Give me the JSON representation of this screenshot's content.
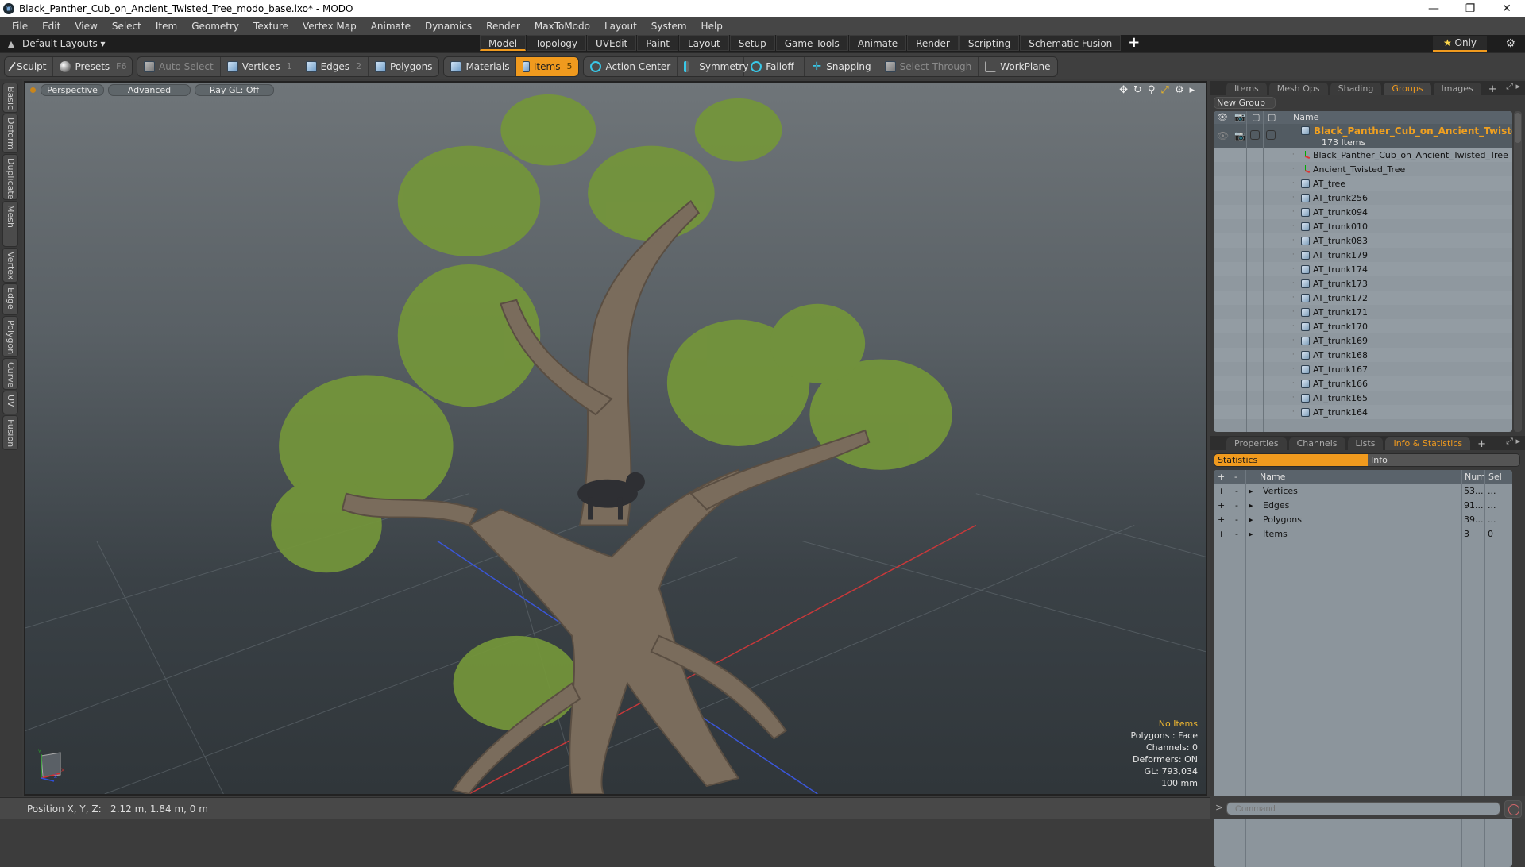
{
  "window": {
    "title": "Black_Panther_Cub_on_Ancient_Twisted_Tree_modo_base.lxo* - MODO",
    "controls": [
      "minimize",
      "maximize",
      "close"
    ]
  },
  "menu": [
    "File",
    "Edit",
    "View",
    "Select",
    "Item",
    "Geometry",
    "Texture",
    "Vertex Map",
    "Animate",
    "Dynamics",
    "Render",
    "MaxToModo",
    "Layout",
    "System",
    "Help"
  ],
  "layouts": {
    "dropdown_label": "Default Layouts",
    "tabs": [
      "Model",
      "Topology",
      "UVEdit",
      "Paint",
      "Layout",
      "Setup",
      "Game Tools",
      "Animate",
      "Render",
      "Scripting",
      "Schematic Fusion"
    ],
    "active_tab": "Model",
    "add_label": "+",
    "only_label": "Only"
  },
  "toolbar": {
    "sculpt": "Sculpt",
    "presets": "Presets",
    "presets_key": "F6",
    "auto_select": "Auto Select",
    "vertices": "Vertices",
    "vertices_key": "1",
    "edges": "Edges",
    "edges_key": "2",
    "polygons": "Polygons",
    "materials": "Materials",
    "items": "Items",
    "items_key": "5",
    "action_center": "Action Center",
    "symmetry": "Symmetry",
    "falloff": "Falloff",
    "snapping": "Snapping",
    "select_through": "Select Through",
    "workplane": "WorkPlane"
  },
  "left_tabs": [
    "Basic",
    "Deform",
    "Duplicate",
    "Mesh Edit",
    "Vertex",
    "Edge",
    "Polygon",
    "Curve",
    "UV",
    "Fusion"
  ],
  "viewport": {
    "view_mode": "Perspective",
    "shading": "Advanced",
    "raygl": "Ray GL: Off",
    "info": {
      "selection": "No Items",
      "mode": "Polygons : Face",
      "channels": "Channels: 0",
      "deformers": "Deformers: ON",
      "gl": "GL: 793,034",
      "grid": "100 mm"
    },
    "axes": {
      "x": "X",
      "y": "Y",
      "z": "Z"
    },
    "colors": {
      "x_axis": "#d03030",
      "z_axis": "#3050e0",
      "foliage": "#7a9a3a",
      "bark": "#7c6e5c"
    }
  },
  "statusbar": {
    "position": "Position X, Y, Z:   2.12 m, 1.84 m, 0 m"
  },
  "groups_panel": {
    "tabs": [
      "Items",
      "Mesh Ops",
      "Shading",
      "Groups",
      "Images"
    ],
    "active_tab": "Groups",
    "new_group": "New Group",
    "column_name": "Name",
    "group_name": "Black_Panther_Cub_on_Ancient_Twisted...",
    "group_count": "173 Items",
    "rows": [
      {
        "name": "Black_Panther_Cub_on_Ancient_Twisted_Tree",
        "type": "locator"
      },
      {
        "name": "Ancient_Twisted_Tree",
        "type": "locator"
      },
      {
        "name": "AT_tree",
        "type": "mesh"
      },
      {
        "name": "AT_trunk256",
        "type": "mesh"
      },
      {
        "name": "AT_trunk094",
        "type": "mesh"
      },
      {
        "name": "AT_trunk010",
        "type": "mesh"
      },
      {
        "name": "AT_trunk083",
        "type": "mesh"
      },
      {
        "name": "AT_trunk179",
        "type": "mesh"
      },
      {
        "name": "AT_trunk174",
        "type": "mesh"
      },
      {
        "name": "AT_trunk173",
        "type": "mesh"
      },
      {
        "name": "AT_trunk172",
        "type": "mesh"
      },
      {
        "name": "AT_trunk171",
        "type": "mesh"
      },
      {
        "name": "AT_trunk170",
        "type": "mesh"
      },
      {
        "name": "AT_trunk169",
        "type": "mesh"
      },
      {
        "name": "AT_trunk168",
        "type": "mesh"
      },
      {
        "name": "AT_trunk167",
        "type": "mesh"
      },
      {
        "name": "AT_trunk166",
        "type": "mesh"
      },
      {
        "name": "AT_trunk165",
        "type": "mesh"
      },
      {
        "name": "AT_trunk164",
        "type": "mesh"
      }
    ]
  },
  "info_panel": {
    "tabs": [
      "Properties",
      "Channels",
      "Lists",
      "Info & Statistics"
    ],
    "active_tab": "Info & Statistics",
    "subtabs": [
      "Statistics",
      "Info"
    ],
    "active_subtab": "Statistics",
    "columns": {
      "plus": "+",
      "minus": "-",
      "name": "Name",
      "num": "Num",
      "sel": "Sel"
    },
    "rows": [
      {
        "name": "Vertices",
        "num": "53...",
        "sel": "..."
      },
      {
        "name": "Edges",
        "num": "91...",
        "sel": "..."
      },
      {
        "name": "Polygons",
        "num": "39...",
        "sel": "..."
      },
      {
        "name": "Items",
        "num": "3",
        "sel": "0"
      }
    ]
  },
  "command": {
    "prompt": ">",
    "placeholder": "Command"
  },
  "colors": {
    "accent": "#f09a1e",
    "group_title": "#f0a020"
  }
}
